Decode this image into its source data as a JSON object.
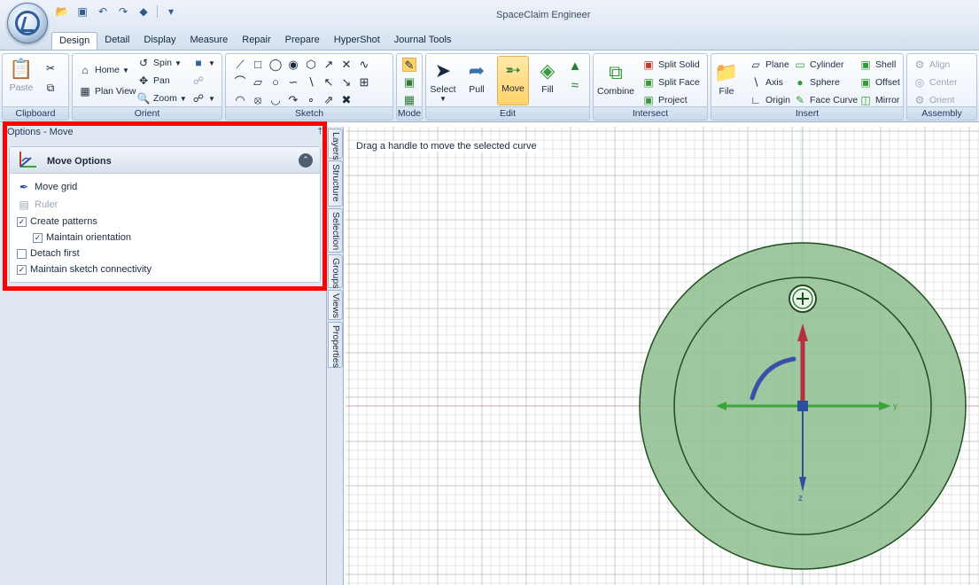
{
  "window": {
    "title": "SpaceClaim Engineer"
  },
  "qat": {
    "icons": [
      "folder-open-icon",
      "save-icon",
      "undo-icon",
      "redo-icon",
      "select-mode-icon",
      "customize-icon"
    ]
  },
  "tabs": [
    "Design",
    "Detail",
    "Display",
    "Measure",
    "Repair",
    "Prepare",
    "HyperShot",
    "Journal Tools"
  ],
  "active_tab": "Design",
  "ribbon": {
    "clipboard": {
      "label": "Clipboard",
      "paste": "Paste"
    },
    "orient": {
      "label": "Orient",
      "home": "Home",
      "plan_view": "Plan View",
      "spin": "Spin",
      "pan": "Pan",
      "zoom": "Zoom"
    },
    "sketch": {
      "label": "Sketch"
    },
    "mode": {
      "label": "Mode"
    },
    "edit": {
      "label": "Edit",
      "select": "Select",
      "pull": "Pull",
      "move": "Move",
      "fill": "Fill"
    },
    "intersect": {
      "label": "Intersect",
      "combine": "Combine",
      "split_solid": "Split Solid",
      "split_face": "Split Face",
      "project": "Project"
    },
    "insert": {
      "label": "Insert",
      "file": "File",
      "plane": "Plane",
      "axis": "Axis",
      "origin": "Origin",
      "cylinder": "Cylinder",
      "sphere": "Sphere",
      "face_curve": "Face Curve",
      "shell": "Shell",
      "offset": "Offset",
      "mirror": "Mirror"
    },
    "assembly": {
      "label": "Assembly",
      "align": "Align",
      "center": "Center",
      "orient": "Orient"
    }
  },
  "left_panel": {
    "title": "Options - Move",
    "pin": "†",
    "section_title": "Move Options",
    "options": {
      "move_grid": "Move grid",
      "ruler": "Ruler",
      "create_patterns": "Create patterns",
      "maintain_orientation": "Maintain orientation",
      "detach_first": "Detach first",
      "maintain_sketch_connectivity": "Maintain sketch connectivity"
    },
    "checked": {
      "create_patterns": true,
      "maintain_orientation": true,
      "detach_first": false,
      "maintain_sketch_connectivity": true
    }
  },
  "side_tabs": [
    "Layers",
    "Structure",
    "Selection",
    "Groups",
    "Views",
    "Properties"
  ],
  "canvas": {
    "hint": "Drag a handle to move the selected curve",
    "axis_y_label": "y",
    "axis_z_label": "z",
    "colors": {
      "fill": "#8fbe8f",
      "outline": "#1f4d1f",
      "x_arrow": "#b4303a",
      "y_arrow": "#3aa43a",
      "z_arrow": "#2d4f9c",
      "rotation": "#3a4fa8",
      "grid": "#c9c9c9",
      "highlight": "#ff0000"
    }
  }
}
